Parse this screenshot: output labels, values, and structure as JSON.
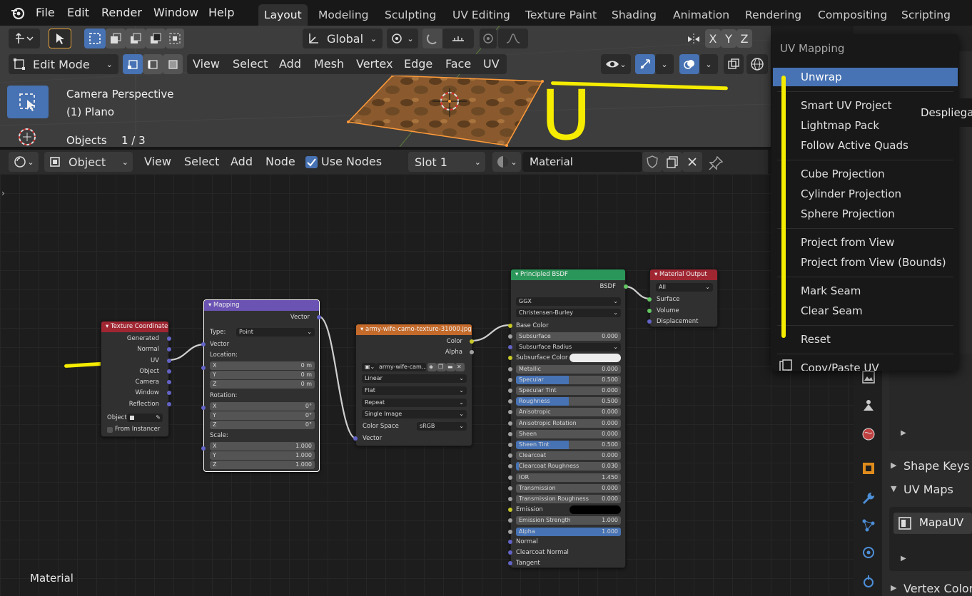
{
  "menubar": {
    "items": [
      "File",
      "Edit",
      "Render",
      "Window",
      "Help"
    ]
  },
  "workspaces": [
    "Layout",
    "Modeling",
    "Sculpting",
    "UV Editing",
    "Texture Paint",
    "Shading",
    "Animation",
    "Rendering",
    "Compositing",
    "Scripting"
  ],
  "viewport": {
    "transform_orientation": "Global",
    "mode": "Edit Mode",
    "menus": [
      "View",
      "Select",
      "Add",
      "Mesh",
      "Vertex",
      "Edge",
      "Face",
      "UV"
    ],
    "axes": [
      "X",
      "Y",
      "Z"
    ],
    "info_line1": "Camera Perspective",
    "info_line2": "(1) Plano",
    "objects_label": "Objects",
    "objects_count": "1 / 3",
    "annotation_letter": "U"
  },
  "node_header": {
    "object_type": "Object",
    "menus": [
      "View",
      "Select",
      "Add",
      "Node"
    ],
    "use_nodes_label": "Use Nodes",
    "slot": "Slot 1",
    "material": "Material"
  },
  "node_editor": {
    "footer_label": "Material",
    "texcoord": {
      "title": "Texture Coordinate",
      "outputs": [
        "Generated",
        "Normal",
        "UV",
        "Object",
        "Camera",
        "Window",
        "Reflection"
      ],
      "object_label": "Object",
      "from_instancer": "From Instancer"
    },
    "mapping": {
      "title": "Mapping",
      "out": "Vector",
      "type_label": "Type:",
      "type_value": "Point",
      "vector": "Vector",
      "location": "Location:",
      "rotation": "Rotation:",
      "scale": "Scale:",
      "loc": [
        [
          "X",
          "0 m"
        ],
        [
          "Y",
          "0 m"
        ],
        [
          "Z",
          "0 m"
        ]
      ],
      "rot": [
        [
          "X",
          "0°"
        ],
        [
          "Y",
          "0°"
        ],
        [
          "Z",
          "0°"
        ]
      ],
      "scl": [
        [
          "X",
          "1.000"
        ],
        [
          "Y",
          "1.000"
        ],
        [
          "Z",
          "1.000"
        ]
      ]
    },
    "image": {
      "title": "army-wife-camo-texture-31000.jpg",
      "out_color": "Color",
      "out_alpha": "Alpha",
      "file": "army-wife-cam...",
      "interp": "Linear",
      "proj": "Flat",
      "ext": "Repeat",
      "source": "Single Image",
      "cs_label": "Color Space",
      "cs_value": "sRGB",
      "vector": "Vector"
    },
    "bsdf": {
      "title": "Principled BSDF",
      "out": "BSDF",
      "dist": "GGX",
      "sss": "Christensen-Burley",
      "base_color": "Base Color",
      "rows": [
        [
          "Subsurface",
          "0.000",
          0
        ],
        [
          "Subsurface Radius",
          "",
          -1
        ],
        [
          "Subsurface Color",
          "",
          -2
        ],
        [
          "Metallic",
          "0.000",
          0
        ],
        [
          "Specular",
          "0.500",
          0.5
        ],
        [
          "Specular Tint",
          "0.000",
          0
        ],
        [
          "Roughness",
          "0.500",
          0.5
        ],
        [
          "Anisotropic",
          "0.000",
          0
        ],
        [
          "Anisotropic Rotation",
          "0.000",
          0
        ],
        [
          "Sheen",
          "0.000",
          0
        ],
        [
          "Sheen Tint",
          "0.500",
          0.5
        ],
        [
          "Clearcoat",
          "0.000",
          0
        ],
        [
          "Clearcoat Roughness",
          "0.030",
          0.03
        ],
        [
          "IOR",
          "1.450",
          0
        ],
        [
          "Transmission",
          "0.000",
          0
        ],
        [
          "Transmission Roughness",
          "0.000",
          0
        ],
        [
          "Emission",
          "",
          -3
        ],
        [
          "Emission Strength",
          "1.000",
          0
        ],
        [
          "Alpha",
          "1.000",
          1
        ]
      ],
      "normal": "Normal",
      "clearcoat_normal": "Clearcoat Normal",
      "tangent": "Tangent"
    },
    "output": {
      "title": "Material Output",
      "target": "All",
      "inputs": [
        "Surface",
        "Volume",
        "Displacement"
      ]
    }
  },
  "uv_menu": {
    "title": "UV Mapping",
    "items": [
      "Unwrap",
      "Smart UV Project",
      "Lightmap Pack",
      "Follow Active Quads",
      "Cube Projection",
      "Cylinder Projection",
      "Sphere Projection",
      "Project from View",
      "Project from View (Bounds)",
      "Mark Seam",
      "Clear Seam",
      "Reset",
      "Copy/Paste UV"
    ],
    "tooltip": "Despliega"
  },
  "properties": {
    "shape_keys": "Shape Keys",
    "uv_maps": "UV Maps",
    "uv_map_name": "MapaUV",
    "vertex_colors": "Vertex Colors"
  },
  "colors": {
    "accent": "#4772b3",
    "annotation": "#f5ec00",
    "texcoord_header": "#a02632",
    "mapping_header": "#6b53b3",
    "image_header": "#c46a2a",
    "bsdf_header": "#2b9659",
    "output_header": "#a02632"
  }
}
